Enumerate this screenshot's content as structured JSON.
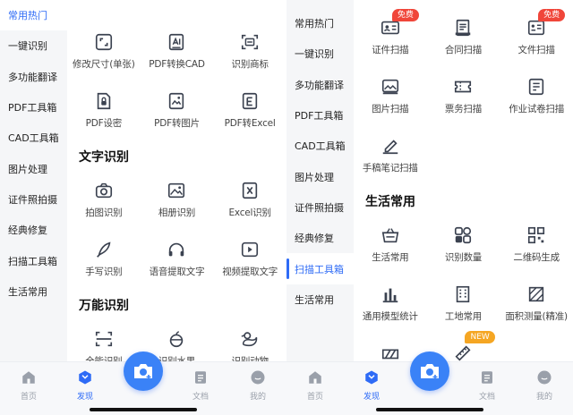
{
  "colors": {
    "accent": "#2e6bf6",
    "sidebar_bg": "#f5f6f8",
    "icon": "#3b4250",
    "badge_red": "#f0463a",
    "badge_orange": "#f5a623"
  },
  "left": {
    "sidebar": [
      "常用热门",
      "一键识别",
      "多功能翻译",
      "PDF工具箱",
      "CAD工具箱",
      "图片处理",
      "证件照拍摄",
      "经典修复",
      "扫描工具箱",
      "生活常用"
    ],
    "row1": [
      {
        "label": "修改尺寸(单张)",
        "icon": "resize-icon"
      },
      {
        "label": "PDF转换CAD",
        "icon": "pdf-to-cad-icon"
      },
      {
        "label": "识别商标",
        "icon": "trademark-scan-icon"
      }
    ],
    "row2": [
      {
        "label": "PDF设密",
        "icon": "pdf-lock-icon"
      },
      {
        "label": "PDF转图片",
        "icon": "pdf-to-image-icon"
      },
      {
        "label": "PDF转Excel",
        "icon": "pdf-to-excel-icon"
      }
    ],
    "section_text": "文字识别",
    "row3": [
      {
        "label": "拍图识别",
        "icon": "photo-recognize-icon"
      },
      {
        "label": "相册识别",
        "icon": "album-recognize-icon"
      },
      {
        "label": "Excel识别",
        "icon": "excel-recognize-icon"
      }
    ],
    "row4": [
      {
        "label": "手写识别",
        "icon": "handwriting-icon"
      },
      {
        "label": "语音提取文字",
        "icon": "voice-extract-icon"
      },
      {
        "label": "视频提取文字",
        "icon": "video-extract-icon"
      }
    ],
    "section_all": "万能识别",
    "row5": [
      {
        "label": "全能识别",
        "icon": "scan-all-icon"
      },
      {
        "label": "识别水果",
        "icon": "fruit-icon"
      },
      {
        "label": "识别动物",
        "icon": "animal-icon"
      }
    ]
  },
  "right": {
    "sidebar": [
      "常用热门",
      "一键识别",
      "多功能翻译",
      "PDF工具箱",
      "CAD工具箱",
      "图片处理",
      "证件照拍摄",
      "经典修复",
      "扫描工具箱",
      "生活常用"
    ],
    "row1": [
      {
        "label": "证件扫描",
        "icon": "id-scan-icon",
        "badge": "免费"
      },
      {
        "label": "合同扫描",
        "icon": "contract-scan-icon"
      },
      {
        "label": "文件扫描",
        "icon": "file-scan-icon",
        "badge": "免费"
      }
    ],
    "row2": [
      {
        "label": "图片扫描",
        "icon": "image-scan-icon"
      },
      {
        "label": "票务扫描",
        "icon": "ticket-scan-icon"
      },
      {
        "label": "作业试卷扫描",
        "icon": "exam-scan-icon"
      }
    ],
    "row3": [
      {
        "label": "手稿笔记扫描",
        "icon": "notes-scan-icon"
      }
    ],
    "section_life": "生活常用",
    "row4": [
      {
        "label": "生活常用",
        "icon": "basket-icon"
      },
      {
        "label": "识别数量",
        "icon": "count-icon"
      },
      {
        "label": "二维码生成",
        "icon": "qrcode-icon"
      }
    ],
    "row5": [
      {
        "label": "通用模型统计",
        "icon": "bar-chart-icon"
      },
      {
        "label": "工地常用",
        "icon": "building-icon"
      },
      {
        "label": "面积测量(精准)",
        "icon": "area-measure-icon"
      }
    ],
    "row6_badge": "NEW"
  },
  "tabs": [
    "首页",
    "发现",
    "文档",
    "我的"
  ]
}
